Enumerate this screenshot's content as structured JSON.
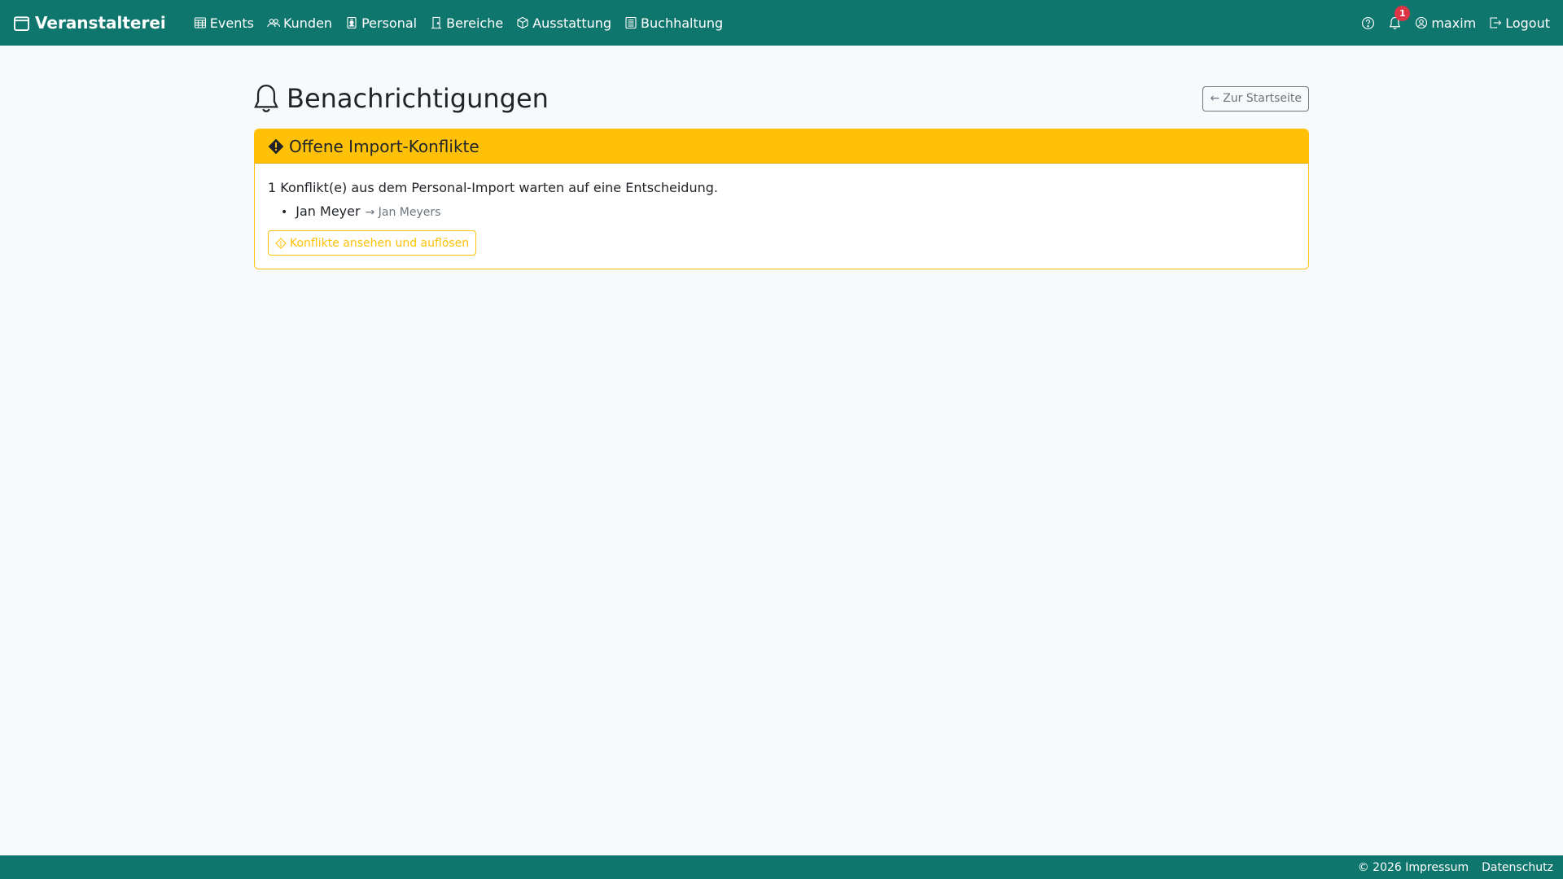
{
  "navbar": {
    "brand": "Veranstalterei",
    "items": [
      {
        "label": "Events",
        "icon": "calendar-grid-icon"
      },
      {
        "label": "Kunden",
        "icon": "people-icon"
      },
      {
        "label": "Personal",
        "icon": "person-badge-icon"
      },
      {
        "label": "Bereiche",
        "icon": "door-icon"
      },
      {
        "label": "Ausstattung",
        "icon": "box-icon"
      },
      {
        "label": "Buchhaltung",
        "icon": "ledger-icon"
      }
    ],
    "notification_count": "1",
    "username": "maxim",
    "logout": "Logout"
  },
  "page": {
    "title": "Benachrichtigungen",
    "back_button": "Zur Startseite"
  },
  "conflict_card": {
    "header": "Offene Import-Konflikte",
    "text": "1 Konflikt(e) aus dem Personal-Import warten auf eine Entscheidung.",
    "items": [
      {
        "source": "Jan Meyer",
        "arrow": "→",
        "target": "Jan Meyers"
      }
    ],
    "action_button": "Konflikte ansehen und auflösen"
  },
  "footer": {
    "copyright": "© 2026 Impressum",
    "privacy": "Datenschutz"
  },
  "colors": {
    "navbar": "#0f766e",
    "warning": "#ffc107",
    "badge": "#dc3545",
    "background": "#f8f9fa"
  }
}
